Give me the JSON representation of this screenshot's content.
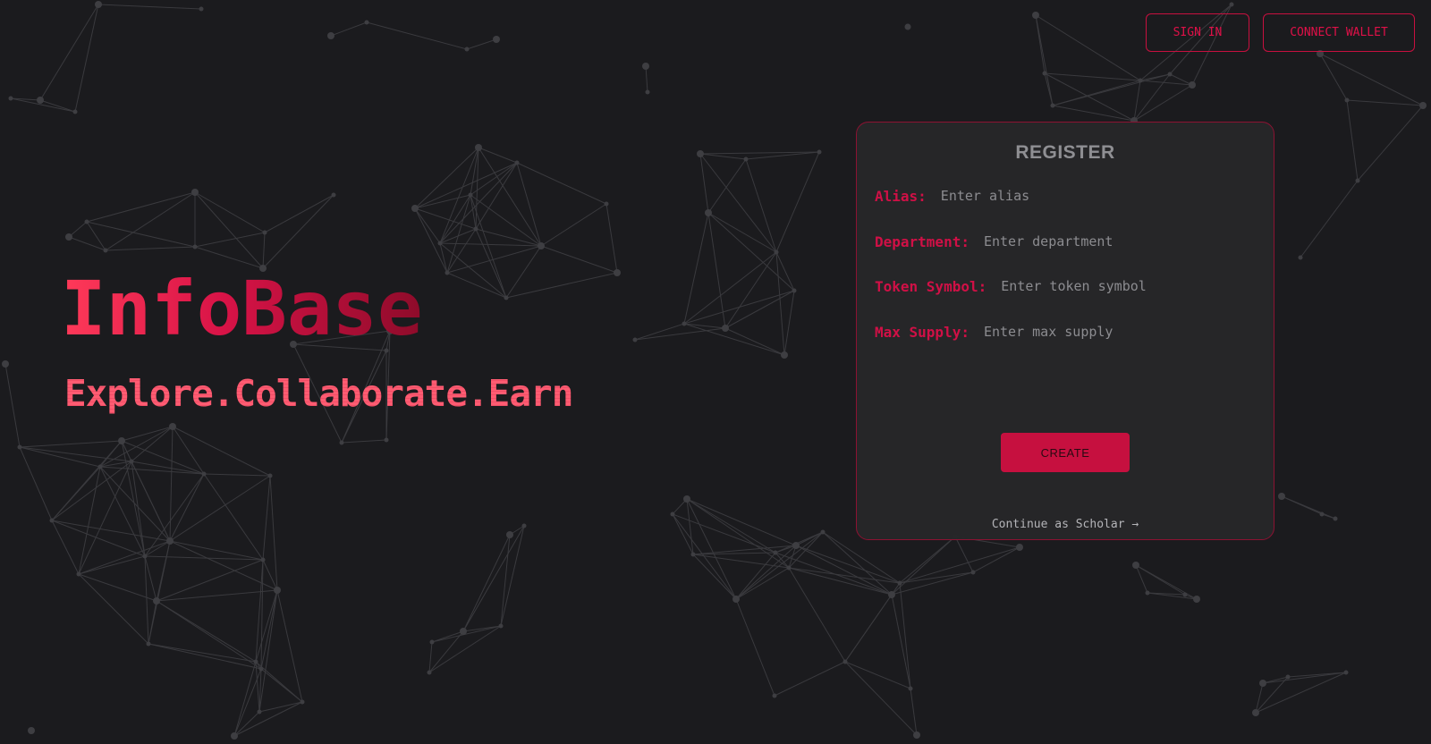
{
  "header": {
    "signin_label": "SIGN IN",
    "wallet_label": "CONNECT WALLET"
  },
  "hero": {
    "title": "InfoBase",
    "subtitle": "Explore.Collaborate.Earn"
  },
  "register": {
    "title": "REGISTER",
    "fields": [
      {
        "label": "Alias:",
        "placeholder": "Enter alias",
        "value": ""
      },
      {
        "label": "Department:",
        "placeholder": "Enter department",
        "value": ""
      },
      {
        "label": "Token Symbol:",
        "placeholder": "Enter token symbol",
        "value": ""
      },
      {
        "label": "Max Supply:",
        "placeholder": "Enter max supply",
        "value": ""
      }
    ],
    "create_label": "CREATE",
    "scholar_link": "Continue as Scholar →"
  },
  "colors": {
    "background": "#1b1b1e",
    "accent": "#c8103f",
    "card_background": "#262629",
    "card_border": "#8c1232",
    "muted_text": "#8f8f93"
  },
  "background_decoration": "network-graph-icon"
}
